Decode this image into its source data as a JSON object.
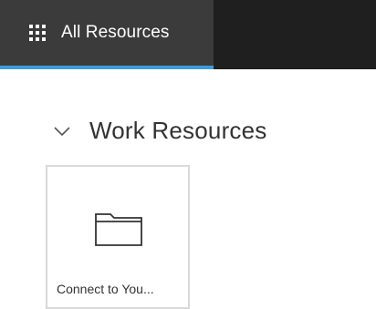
{
  "header": {
    "tab_label": "All Resources",
    "active_tab_color": "#3d9cdc",
    "icon": "app-launcher-icon"
  },
  "section": {
    "title": "Work Resources",
    "expanded": true,
    "icon": "chevron-down-icon"
  },
  "resources": [
    {
      "label": "Connect to You...",
      "icon": "folder-icon"
    }
  ]
}
